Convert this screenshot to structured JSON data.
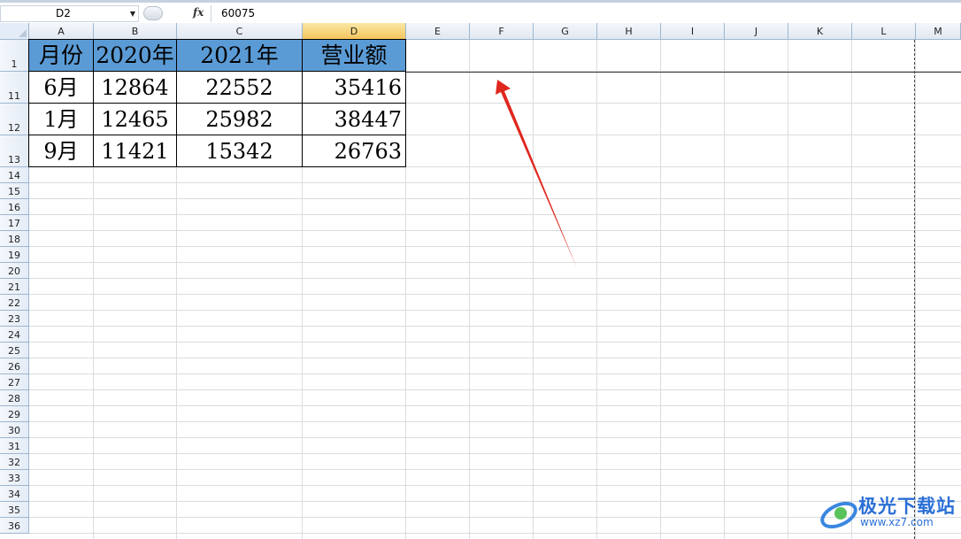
{
  "formula_bar": {
    "name_box": "D2",
    "formula_icon": "fx",
    "formula_value": "60075"
  },
  "columns": [
    "A",
    "B",
    "C",
    "D",
    "E",
    "F",
    "G",
    "H",
    "I",
    "J",
    "K",
    "L",
    "M"
  ],
  "selected_column": "D",
  "rows": [
    {
      "header": "1",
      "cells": [
        "月份",
        "2020年",
        "2021年",
        "营业额"
      ]
    },
    {
      "header": "11",
      "cells": [
        "6月",
        "12864",
        "22552",
        "35416"
      ]
    },
    {
      "header": "12",
      "cells": [
        "1月",
        "12465",
        "25982",
        "38447"
      ]
    },
    {
      "header": "13",
      "cells": [
        "9月",
        "11421",
        "15342",
        "26763"
      ]
    }
  ],
  "empty_rows": [
    "14",
    "15",
    "16",
    "17",
    "18",
    "19",
    "20",
    "21",
    "22",
    "23",
    "24",
    "25",
    "26",
    "27",
    "28",
    "29",
    "30",
    "31",
    "32",
    "33",
    "34",
    "35",
    "36"
  ],
  "colors": {
    "header_fill": "#5b9bd5",
    "selected_column_header": "#f5c65d",
    "annotation_arrow": "#e0271e"
  },
  "watermark": {
    "text": "极光下载站",
    "url": "www.xz7.com"
  }
}
